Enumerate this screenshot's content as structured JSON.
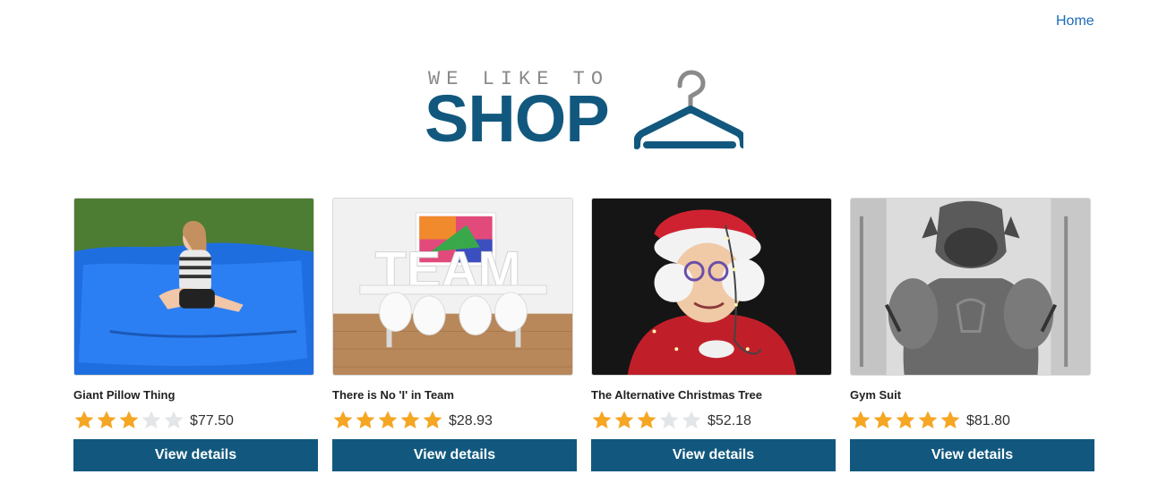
{
  "nav": {
    "home_label": "Home"
  },
  "logo": {
    "tagline": "WE LIKE TO",
    "word": "SHOP",
    "icon": "hanger-icon"
  },
  "colors": {
    "brand": "#12587e",
    "link": "#1c6cb7",
    "star_filled": "#f5a623",
    "star_empty": "#e3e6e8"
  },
  "products": [
    {
      "title": "Giant Pillow Thing",
      "rating": 3,
      "max_rating": 5,
      "price": "$77.50",
      "button_label": "View details"
    },
    {
      "title": "There is No 'I' in Team",
      "rating": 5,
      "max_rating": 5,
      "price": "$28.93",
      "button_label": "View details"
    },
    {
      "title": "The Alternative Christmas Tree",
      "rating": 3,
      "max_rating": 5,
      "price": "$52.18",
      "button_label": "View details"
    },
    {
      "title": "Gym Suit",
      "rating": 5,
      "max_rating": 5,
      "price": "$81.80",
      "button_label": "View details"
    }
  ]
}
